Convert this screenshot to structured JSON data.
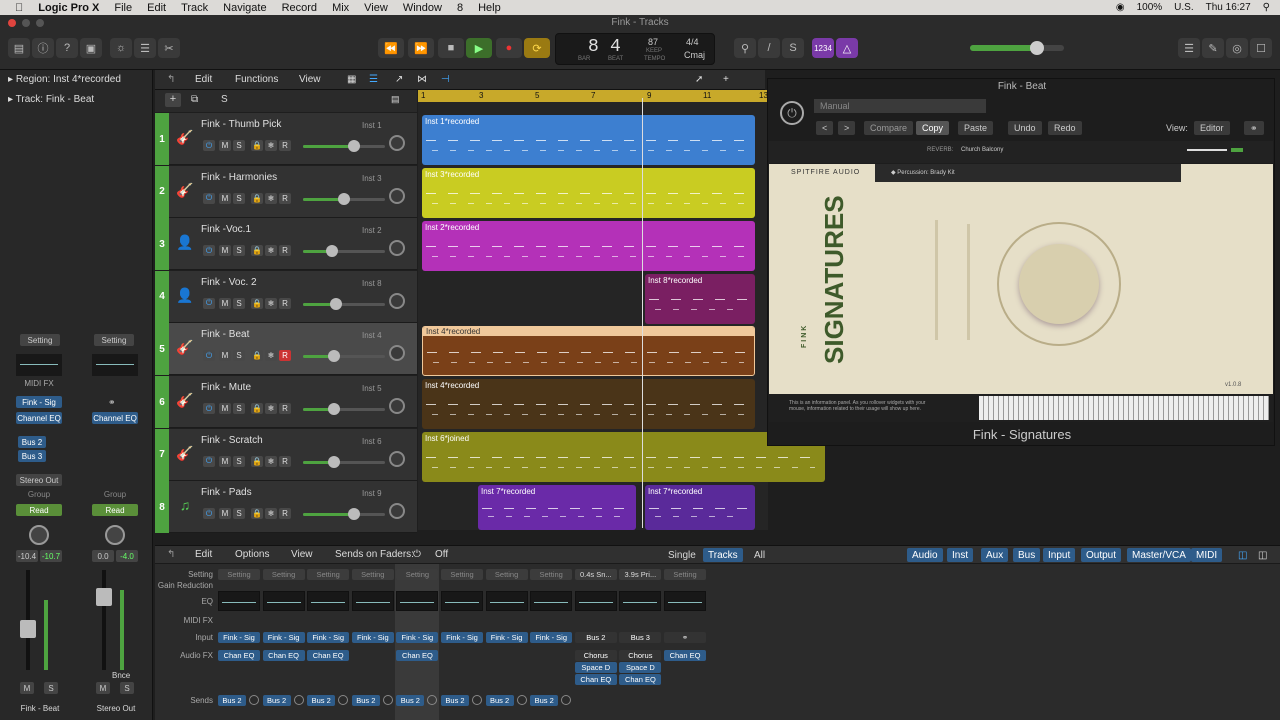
{
  "menubar": {
    "app": "Logic Pro X",
    "items": [
      "File",
      "Edit",
      "Track",
      "Navigate",
      "Record",
      "Mix",
      "View",
      "Window",
      "8",
      "Help"
    ],
    "battery": "100%",
    "locale": "U.S.",
    "clock": "Thu 16:27"
  },
  "window": {
    "title": "Fink - Tracks"
  },
  "lcd": {
    "bar": "8",
    "beat": "4",
    "bar_lbl": "BAR",
    "beat_lbl": "BEAT",
    "tempo": "87",
    "keep": "KEEP",
    "tempo_lbl": "TEMPO",
    "sig": "4/4",
    "key": "Cmaj",
    "count_in": "1234"
  },
  "inspector": {
    "region_label": "Region:",
    "region_name": "Inst 4*recorded",
    "track_label": "Track:",
    "track_name": "Fink - Beat",
    "strip1": {
      "setting": "Setting",
      "midifx": "MIDI FX",
      "input": "Fink - Sig",
      "eq": "Channel EQ",
      "sends": [
        "Bus 2",
        "Bus 3"
      ],
      "output": "Stereo Out",
      "group": "Group",
      "auto": "Read",
      "vol": "-10.4",
      "peak": "-10.7",
      "m": "M",
      "s": "S",
      "name": "Fink - Beat"
    },
    "strip2": {
      "setting": "Setting",
      "eq": "Channel EQ",
      "group": "Group",
      "auto": "Read",
      "vol": "0.0",
      "peak": "-4.0",
      "bnce": "Bnce",
      "m": "M",
      "s": "S",
      "name": "Stereo Out"
    }
  },
  "tracks_header": {
    "edit": "Edit",
    "functions": "Functions",
    "view": "View",
    "add": "+",
    "s": "S"
  },
  "tracks": [
    {
      "num": "1",
      "name": "Fink - Thumb Pick",
      "inst": "Inst 1",
      "fader": 0.62
    },
    {
      "num": "2",
      "name": "Fink - Harmonies",
      "inst": "Inst 3",
      "fader": 0.5
    },
    {
      "num": "3",
      "name": "Fink -Voc.1",
      "inst": "Inst 2",
      "fader": 0.35
    },
    {
      "num": "4",
      "name": "Fink - Voc. 2",
      "inst": "Inst 8",
      "fader": 0.4
    },
    {
      "num": "5",
      "name": "Fink - Beat",
      "inst": "Inst 4",
      "fader": 0.38
    },
    {
      "num": "6",
      "name": "Fink - Mute",
      "inst": "Inst 5",
      "fader": 0.38
    },
    {
      "num": "7",
      "name": "Fink - Scratch",
      "inst": "Inst 6",
      "fader": 0.38
    },
    {
      "num": "8",
      "name": "Fink - Pads",
      "inst": "Inst 9",
      "fader": 0.62
    }
  ],
  "track_buttons": {
    "m": "M",
    "s": "S",
    "r": "R"
  },
  "ruler": [
    "1",
    "3",
    "5",
    "7",
    "9",
    "11",
    "13"
  ],
  "regions": [
    {
      "label": "Inst 1*recorded",
      "color": "#3d7fd0"
    },
    {
      "label": "Inst 3*recorded",
      "color": "#c9cc22"
    },
    {
      "label": "Inst 2*recorded",
      "color": "#b431b8"
    },
    {
      "label": "Inst 8*recorded",
      "color": "#7a1f62"
    },
    {
      "label": "Inst 4*recorded",
      "color": "#7a4018"
    },
    {
      "label": "Inst 4*recorded",
      "color": "#4a3418"
    },
    {
      "label": "Inst 6*joined",
      "color": "#8a8a1a"
    },
    {
      "label": "Inst 7*recorded",
      "color": "#6a2aa8"
    },
    {
      "label": "Inst 7*recorded",
      "color": "#5a2a9a"
    }
  ],
  "plugin": {
    "title": "Fink - Beat",
    "preset": "Manual",
    "compare": "Compare",
    "copy": "Copy",
    "paste": "Paste",
    "undo": "Undo",
    "redo": "Redo",
    "view_label": "View:",
    "view": "Editor",
    "brand": "SPITFIRE AUDIO",
    "patch": "Percussion: Brady Kit",
    "reverb_lbl": "REVERB:",
    "reverb": "Church Balcony",
    "product": "SIGNATURES",
    "artist": "FINK",
    "version": "v1.0.8",
    "info": "This is an information panel. As you rollover widgets with your mouse, information related to their usage will show up here.",
    "footer": "Fink - Signatures"
  },
  "mixer": {
    "edit": "Edit",
    "options": "Options",
    "view": "View",
    "sends_on_faders": "Sends on Faders:",
    "off": "Off",
    "tabs_left": [
      "Single",
      "Tracks",
      "All"
    ],
    "tabs_right": [
      "Audio",
      "Inst",
      "Aux",
      "Bus",
      "Input",
      "Output",
      "Master/VCA",
      "MIDI"
    ],
    "row_labels": [
      "Setting",
      "Gain Reduction",
      "EQ",
      "MIDI FX",
      "Input",
      "Audio FX",
      "Sends"
    ],
    "strips": [
      {
        "setting": "Setting",
        "input": "Fink - Sig",
        "fx": "Chan EQ",
        "send": "Bus 2"
      },
      {
        "setting": "Setting",
        "input": "Fink - Sig",
        "fx": "Chan EQ",
        "send": "Bus 2"
      },
      {
        "setting": "Setting",
        "input": "Fink - Sig",
        "fx": "Chan EQ",
        "send": "Bus 2"
      },
      {
        "setting": "Setting",
        "input": "Fink - Sig",
        "fx": "",
        "send": "Bus 2"
      },
      {
        "setting": "Setting",
        "input": "Fink - Sig",
        "fx": "Chan EQ",
        "send": "Bus 2"
      },
      {
        "setting": "Setting",
        "input": "Fink - Sig",
        "fx": "",
        "send": "Bus 2"
      },
      {
        "setting": "Setting",
        "input": "Fink - Sig",
        "fx": "",
        "send": "Bus 2"
      },
      {
        "setting": "Setting",
        "input": "Fink - Sig",
        "fx": "",
        "send": "Bus 2"
      },
      {
        "setting": "0.4s Sn...",
        "input": "Bus 2",
        "fx": "Chorus",
        "fx2": "Space D",
        "fx3": "Chan EQ",
        "send": ""
      },
      {
        "setting": "3.9s Pri...",
        "input": "Bus 3",
        "fx": "Chorus",
        "fx2": "Space D",
        "fx3": "Chan EQ",
        "send": ""
      },
      {
        "setting": "Setting",
        "input": "",
        "fx": "Chan EQ",
        "send": ""
      }
    ]
  }
}
